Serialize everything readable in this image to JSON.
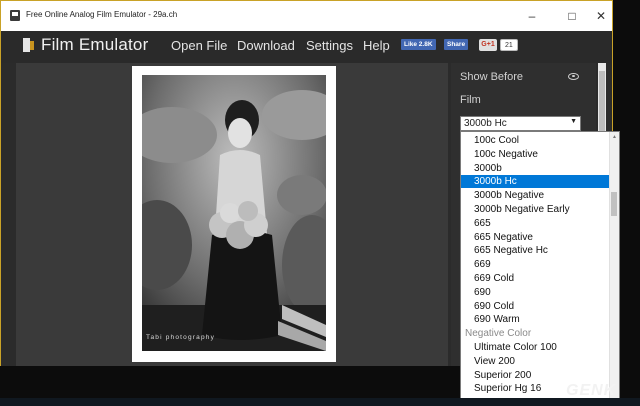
{
  "window": {
    "title": "Free Online Analog Film Emulator - 29a.ch",
    "controls": [
      "minimize",
      "maximize",
      "close"
    ]
  },
  "nav": {
    "brand": "Film Emulator",
    "links": [
      "Open File",
      "Download",
      "Settings",
      "Help"
    ],
    "fb_like": "Like 2.8K",
    "fb_share": "Share",
    "gplus": "G+1",
    "gplus_count": "21"
  },
  "photo": {
    "watermark": "Tabi photography"
  },
  "panel": {
    "show_before": "Show Before",
    "film_label": "Film",
    "selected_value": "3000b Hc"
  },
  "dropdown": {
    "options": [
      {
        "label": "100c Cool",
        "type": "item"
      },
      {
        "label": "100c Negative",
        "type": "item"
      },
      {
        "label": "3000b",
        "type": "item"
      },
      {
        "label": "3000b Hc",
        "type": "selected"
      },
      {
        "label": "3000b Negative",
        "type": "item"
      },
      {
        "label": "3000b Negative Early",
        "type": "item"
      },
      {
        "label": "665",
        "type": "item"
      },
      {
        "label": "665 Negative",
        "type": "item"
      },
      {
        "label": "665 Negative Hc",
        "type": "item"
      },
      {
        "label": "669",
        "type": "item"
      },
      {
        "label": "669 Cold",
        "type": "item"
      },
      {
        "label": "690",
        "type": "item"
      },
      {
        "label": "690 Cold",
        "type": "item"
      },
      {
        "label": "690 Warm",
        "type": "item"
      },
      {
        "label": "Negative Color",
        "type": "group"
      },
      {
        "label": "Ultimate Color 100",
        "type": "item"
      },
      {
        "label": "View 200",
        "type": "item"
      },
      {
        "label": "Superior 200",
        "type": "item"
      },
      {
        "label": "Superior Hg 16",
        "type": "item"
      }
    ]
  },
  "colors": {
    "accent_select": "#0078d7",
    "nav_bg": "#2a2a2a",
    "facebook": "#4267b2",
    "window_border": "#c9a227"
  },
  "overlay": {
    "watermark_logo": "GENK"
  }
}
